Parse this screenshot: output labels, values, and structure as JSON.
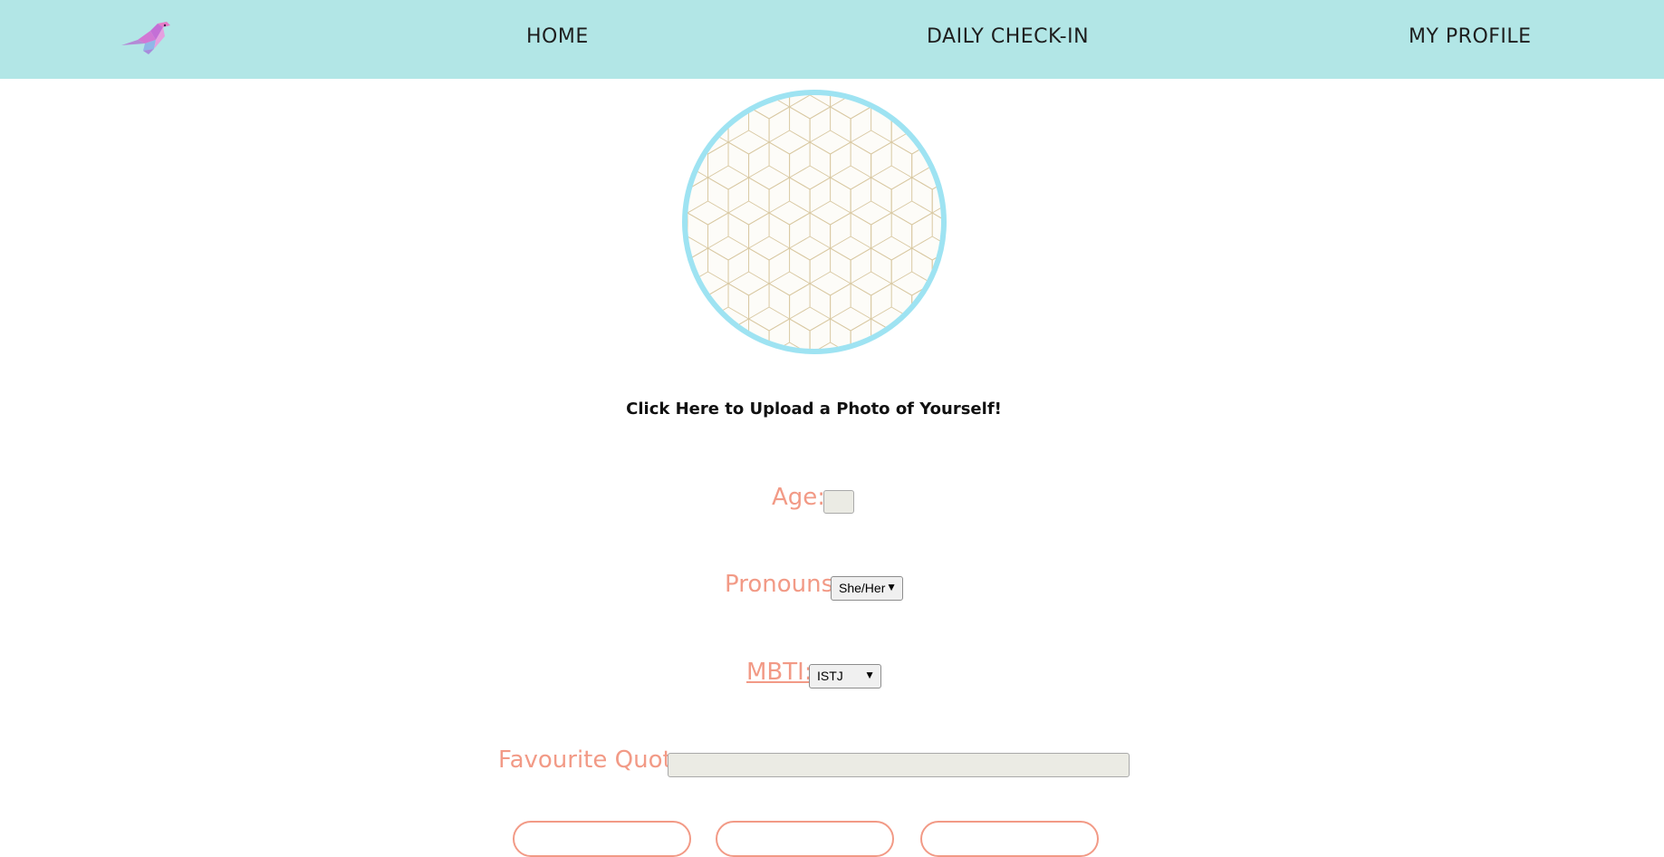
{
  "nav": {
    "logo": "bird-logo-icon",
    "items": [
      {
        "label": "HOME"
      },
      {
        "label": "DAILY CHECK-IN"
      },
      {
        "label": "MY PROFILE"
      }
    ]
  },
  "profile": {
    "avatar": "profile-photo-placeholder",
    "upload_text": "Click Here to Upload a Photo of Yourself!"
  },
  "form": {
    "age": {
      "label": "Age:",
      "value": ""
    },
    "pronouns": {
      "label": "Pronouns:",
      "selected": "She/Her"
    },
    "mbti": {
      "label": "MBTI:",
      "selected": "ISTJ"
    },
    "quote": {
      "label": "Favourite Quote:",
      "value": ""
    }
  },
  "colors": {
    "navbar_bg": "#b2e6e6",
    "label_color": "#f29a86",
    "avatar_border": "#9ee3f2",
    "pattern_line": "#d9c9a3"
  }
}
